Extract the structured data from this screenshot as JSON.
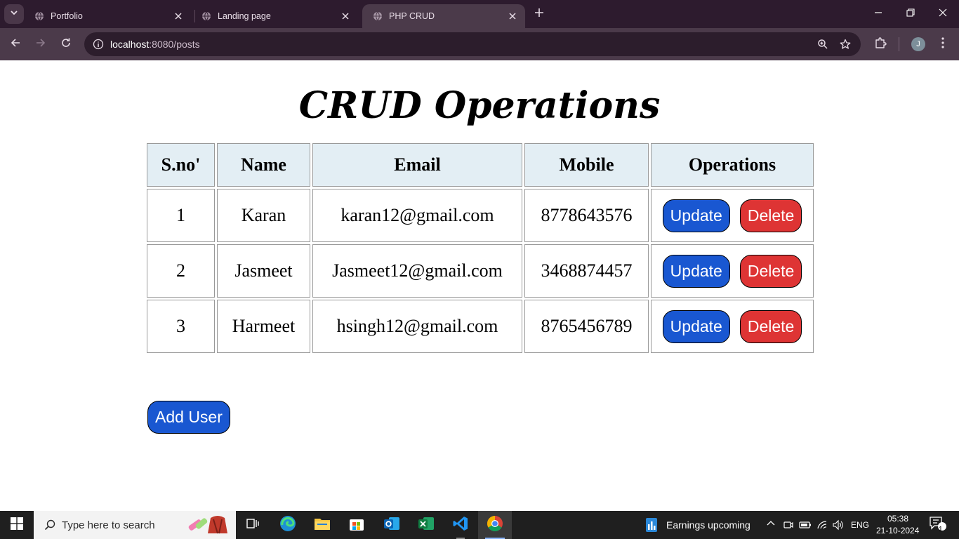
{
  "browser": {
    "tabs": [
      {
        "title": "Portfolio",
        "active": false
      },
      {
        "title": "Landing page",
        "active": false
      },
      {
        "title": "PHP CRUD",
        "active": true
      }
    ],
    "url": {
      "host": "localhost",
      "path": ":8080/posts"
    },
    "profile_initial": "J"
  },
  "page": {
    "title": "CRUD Operations",
    "table": {
      "headers": [
        "S.no'",
        "Name",
        "Email",
        "Mobile",
        "Operations"
      ],
      "rows": [
        {
          "sno": "1",
          "name": "Karan",
          "email": "karan12@gmail.com",
          "mobile": "8778643576"
        },
        {
          "sno": "2",
          "name": "Jasmeet",
          "email": "Jasmeet12@gmail.com",
          "mobile": "3468874457"
        },
        {
          "sno": "3",
          "name": "Harmeet",
          "email": "hsingh12@gmail.com",
          "mobile": "8765456789"
        }
      ],
      "update_label": "Update",
      "delete_label": "Delete"
    },
    "add_user_label": "Add User"
  },
  "taskbar": {
    "search_placeholder": "Type here to search",
    "widget_text": "Earnings upcoming",
    "language": "ENG",
    "time": "05:38",
    "date": "21-10-2024",
    "notification_count": "1"
  },
  "colors": {
    "update_button": "#1957d1",
    "delete_button": "#de3434",
    "header_bg": "#e3eef4",
    "tabstrip_bg": "#2d1b2e",
    "toolbar_bg": "#4b3a4a"
  }
}
